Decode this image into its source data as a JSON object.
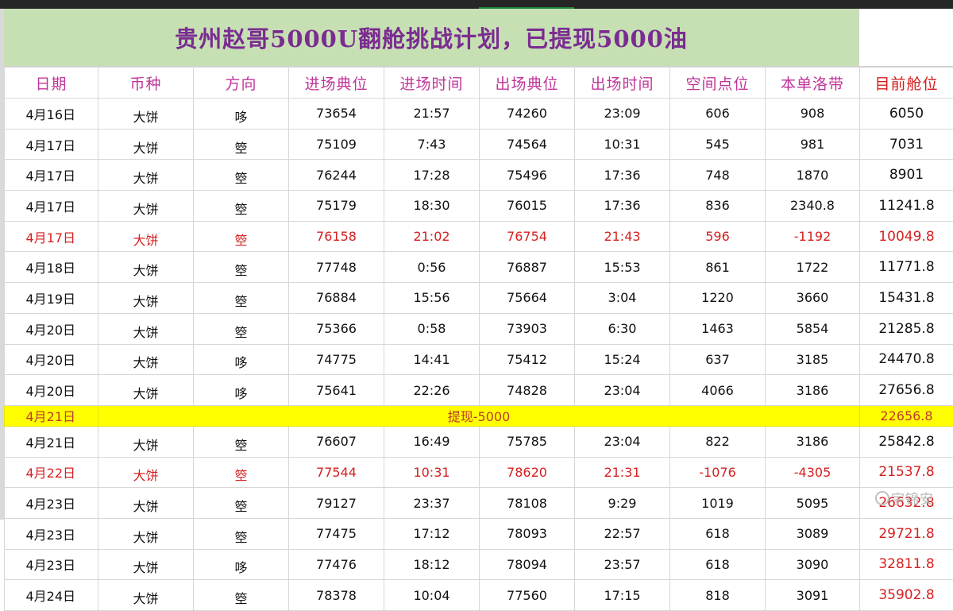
{
  "title": "贵州赵哥5000U翻舱挑战计划，已提现5000油",
  "headers": [
    "日期",
    "币种",
    "方向",
    "进场典位",
    "进场时间",
    "出场典位",
    "出场时间",
    "空间点位",
    "本单洛带",
    "目前舱位"
  ],
  "rows_before": [
    {
      "cells": [
        "4月16日",
        "大饼",
        "哆",
        "73654",
        "21:57",
        "74260",
        "23:09",
        "606",
        "908",
        "6050"
      ],
      "loss": false,
      "red_last": false
    },
    {
      "cells": [
        "4月17日",
        "大饼",
        "箜",
        "75109",
        "7:43",
        "74564",
        "10:31",
        "545",
        "981",
        "7031"
      ],
      "loss": false,
      "red_last": false
    },
    {
      "cells": [
        "4月17日",
        "大饼",
        "箜",
        "76244",
        "17:28",
        "75496",
        "17:36",
        "748",
        "1870",
        "8901"
      ],
      "loss": false,
      "red_last": false
    },
    {
      "cells": [
        "4月17日",
        "大饼",
        "箜",
        "75179",
        "18:30",
        "76015",
        "17:36",
        "836",
        "2340.8",
        "11241.8"
      ],
      "loss": false,
      "red_last": false
    },
    {
      "cells": [
        "4月17日",
        "大饼",
        "箜",
        "76158",
        "21:02",
        "76754",
        "21:43",
        "596",
        "-1192",
        "10049.8"
      ],
      "loss": true,
      "red_last": false
    },
    {
      "cells": [
        "4月18日",
        "大饼",
        "箜",
        "77748",
        "0:56",
        "76887",
        "15:53",
        "861",
        "1722",
        "11771.8"
      ],
      "loss": false,
      "red_last": false
    },
    {
      "cells": [
        "4月19日",
        "大饼",
        "箜",
        "76884",
        "15:56",
        "75664",
        "3:04",
        "1220",
        "3660",
        "15431.8"
      ],
      "loss": false,
      "red_last": false
    },
    {
      "cells": [
        "4月20日",
        "大饼",
        "箜",
        "75366",
        "0:58",
        "73903",
        "6:30",
        "1463",
        "5854",
        "21285.8"
      ],
      "loss": false,
      "red_last": false
    },
    {
      "cells": [
        "4月20日",
        "大饼",
        "哆",
        "74775",
        "14:41",
        "75412",
        "15:24",
        "637",
        "3185",
        "24470.8"
      ],
      "loss": false,
      "red_last": false
    },
    {
      "cells": [
        "4月20日",
        "大饼",
        "哆",
        "75641",
        "22:26",
        "74828",
        "23:04",
        "4066",
        "3186",
        "27656.8"
      ],
      "loss": false,
      "red_last": false
    }
  ],
  "withdraw_row": {
    "date": "4月21日",
    "label": "提现-5000",
    "balance": "22656.8"
  },
  "rows_after": [
    {
      "cells": [
        "4月21日",
        "大饼",
        "箜",
        "76607",
        "16:49",
        "75785",
        "23:04",
        "822",
        "3186",
        "25842.8"
      ],
      "loss": false,
      "red_last": false
    },
    {
      "cells": [
        "4月22日",
        "大饼",
        "箜",
        "77544",
        "10:31",
        "78620",
        "21:31",
        "-1076",
        "-4305",
        "21537.8"
      ],
      "loss": true,
      "red_last": true
    },
    {
      "cells": [
        "4月23日",
        "大饼",
        "箜",
        "79127",
        "23:37",
        "78108",
        "9:29",
        "1019",
        "5095",
        "26632.8"
      ],
      "loss": false,
      "red_last": true
    },
    {
      "cells": [
        "4月23日",
        "大饼",
        "箜",
        "77475",
        "17:12",
        "78093",
        "22:57",
        "618",
        "3089",
        "29721.8"
      ],
      "loss": false,
      "red_last": true
    },
    {
      "cells": [
        "4月23日",
        "大饼",
        "哆",
        "77476",
        "18:12",
        "78094",
        "23:57",
        "618",
        "3090",
        "32811.8"
      ],
      "loss": false,
      "red_last": true
    },
    {
      "cells": [
        "4月24日",
        "大饼",
        "箜",
        "78378",
        "10:04",
        "77560",
        "17:15",
        "818",
        "3091",
        "35902.8"
      ],
      "loss": false,
      "red_last": true
    }
  ],
  "watermark": "宇锦安",
  "colors": {
    "title_bg": "#c6e0b4",
    "title_text": "#7b2c91",
    "header_text": "#c0359a",
    "loss_text": "#d62020",
    "highlight_bg": "#ffff00"
  }
}
